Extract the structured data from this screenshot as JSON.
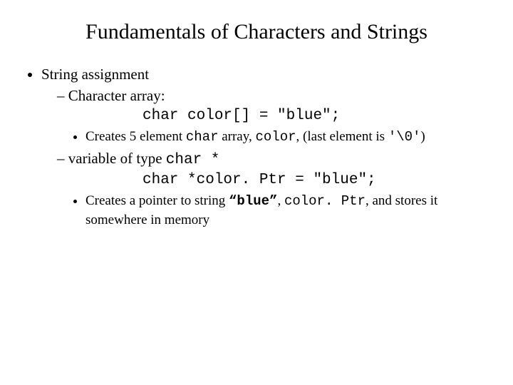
{
  "title": "Fundamentals of Characters and Strings",
  "b1": "String assignment",
  "b1_1": "Character array:",
  "code1": "char color[] = \"blue\";",
  "b1_1_a_pre": "Creates 5 element ",
  "b1_1_a_mid1": "char",
  "b1_1_a_mid2": " array, ",
  "b1_1_a_mid3": "color",
  "b1_1_a_post1": ", (last element is ",
  "b1_1_a_code": "'\\0'",
  "b1_1_a_post2": ")",
  "b1_2_pre": "variable of type ",
  "b1_2_code": "char *",
  "code2": "char *color. Ptr = \"blue\";",
  "b1_2_a_pre": "Creates a pointer to string ",
  "b1_2_a_q": "“blue”",
  "b1_2_a_mid": ", ",
  "b1_2_a_code": "color. Ptr",
  "b1_2_a_post": ", and stores it somewhere in memory"
}
